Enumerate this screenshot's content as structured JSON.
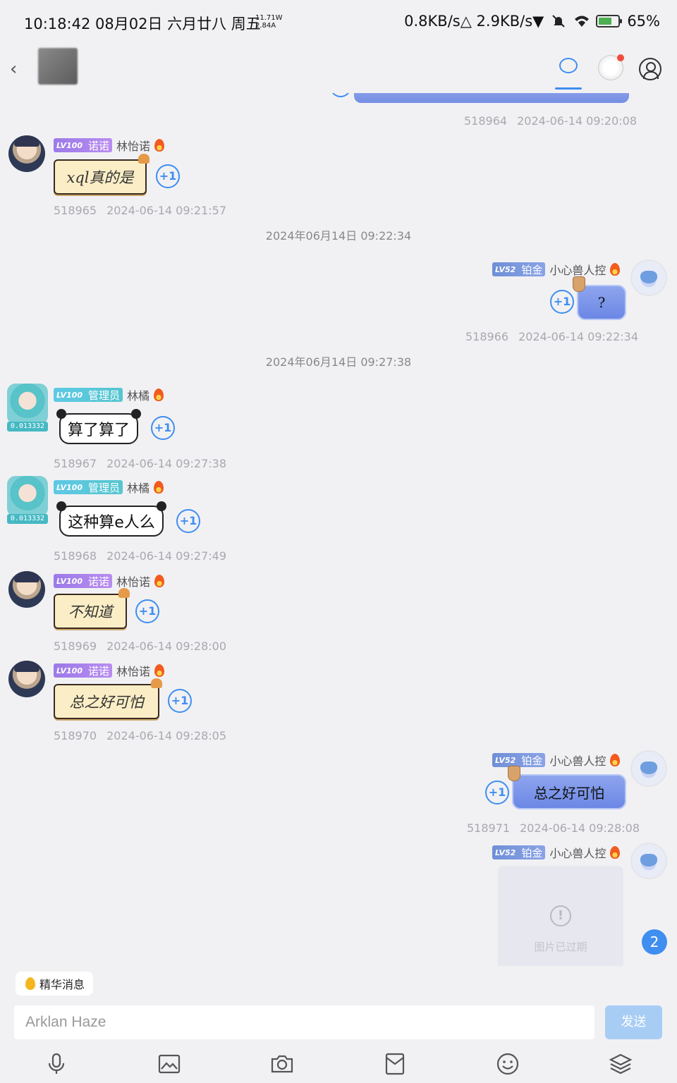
{
  "status": {
    "time": "10:18:42 08月02日 六月廿八 周五",
    "power_top": "11.71W",
    "power_bottom": "2.84A",
    "network": "0.8KB/s△ 2.9KB/s▼",
    "battery": "65%"
  },
  "chat": {
    "top_meta": {
      "id": "518964",
      "time": "2024-06-14 09:20:08"
    },
    "messages": [
      {
        "level": "LV100",
        "title": "诺诺",
        "name": "林怡诺",
        "text": "xql真的是",
        "id": "518965",
        "time": "2024-06-14 09:21:57"
      },
      {
        "level": "LV52",
        "title": "铂金",
        "name": "小心兽人控",
        "text": "?",
        "id": "518966",
        "time": "2024-06-14 09:22:34"
      },
      {
        "level": "LV100",
        "title": "管理员",
        "name": "林橘",
        "text": "算了算了",
        "id": "518967",
        "time": "2024-06-14 09:27:38"
      },
      {
        "level": "LV100",
        "title": "管理员",
        "name": "林橘",
        "text": "这种算e人么",
        "id": "518968",
        "time": "2024-06-14 09:27:49"
      },
      {
        "level": "LV100",
        "title": "诺诺",
        "name": "林怡诺",
        "text": "不知道",
        "id": "518969",
        "time": "2024-06-14 09:28:00"
      },
      {
        "level": "LV100",
        "title": "诺诺",
        "name": "林怡诺",
        "text": "总之好可怕",
        "id": "518970",
        "time": "2024-06-14 09:28:05"
      },
      {
        "level": "LV52",
        "title": "铂金",
        "name": "小心兽人控",
        "text": "总之好可怕",
        "id": "518971",
        "time": "2024-06-14 09:28:08"
      },
      {
        "level": "LV52",
        "title": "铂金",
        "name": "小心兽人控",
        "text": "图片已过期"
      }
    ],
    "time_separators": [
      "2024年06月14日 09:22:34",
      "2024年06月14日 09:27:38"
    ],
    "plus_one": "+1",
    "avatar_badge": "0.013332",
    "unread_count": "2"
  },
  "composer": {
    "featured_label": "精华消息",
    "input_value": "Arklan Haze",
    "send_label": "发送"
  },
  "toolbar_icons": [
    "mic-icon",
    "image-icon",
    "camera-icon",
    "envelope-icon",
    "emoji-icon",
    "layers-icon"
  ]
}
